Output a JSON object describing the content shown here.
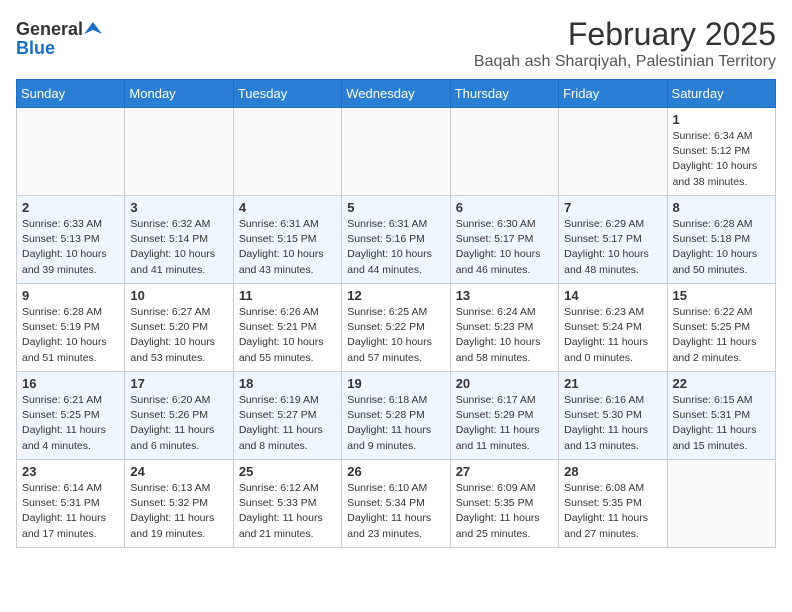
{
  "header": {
    "logo_general": "General",
    "logo_blue": "Blue",
    "month_year": "February 2025",
    "location": "Baqah ash Sharqiyah, Palestinian Territory"
  },
  "weekdays": [
    "Sunday",
    "Monday",
    "Tuesday",
    "Wednesday",
    "Thursday",
    "Friday",
    "Saturday"
  ],
  "weeks": [
    [
      {
        "day": "",
        "info": ""
      },
      {
        "day": "",
        "info": ""
      },
      {
        "day": "",
        "info": ""
      },
      {
        "day": "",
        "info": ""
      },
      {
        "day": "",
        "info": ""
      },
      {
        "day": "",
        "info": ""
      },
      {
        "day": "1",
        "info": "Sunrise: 6:34 AM\nSunset: 5:12 PM\nDaylight: 10 hours\nand 38 minutes."
      }
    ],
    [
      {
        "day": "2",
        "info": "Sunrise: 6:33 AM\nSunset: 5:13 PM\nDaylight: 10 hours\nand 39 minutes."
      },
      {
        "day": "3",
        "info": "Sunrise: 6:32 AM\nSunset: 5:14 PM\nDaylight: 10 hours\nand 41 minutes."
      },
      {
        "day": "4",
        "info": "Sunrise: 6:31 AM\nSunset: 5:15 PM\nDaylight: 10 hours\nand 43 minutes."
      },
      {
        "day": "5",
        "info": "Sunrise: 6:31 AM\nSunset: 5:16 PM\nDaylight: 10 hours\nand 44 minutes."
      },
      {
        "day": "6",
        "info": "Sunrise: 6:30 AM\nSunset: 5:17 PM\nDaylight: 10 hours\nand 46 minutes."
      },
      {
        "day": "7",
        "info": "Sunrise: 6:29 AM\nSunset: 5:17 PM\nDaylight: 10 hours\nand 48 minutes."
      },
      {
        "day": "8",
        "info": "Sunrise: 6:28 AM\nSunset: 5:18 PM\nDaylight: 10 hours\nand 50 minutes."
      }
    ],
    [
      {
        "day": "9",
        "info": "Sunrise: 6:28 AM\nSunset: 5:19 PM\nDaylight: 10 hours\nand 51 minutes."
      },
      {
        "day": "10",
        "info": "Sunrise: 6:27 AM\nSunset: 5:20 PM\nDaylight: 10 hours\nand 53 minutes."
      },
      {
        "day": "11",
        "info": "Sunrise: 6:26 AM\nSunset: 5:21 PM\nDaylight: 10 hours\nand 55 minutes."
      },
      {
        "day": "12",
        "info": "Sunrise: 6:25 AM\nSunset: 5:22 PM\nDaylight: 10 hours\nand 57 minutes."
      },
      {
        "day": "13",
        "info": "Sunrise: 6:24 AM\nSunset: 5:23 PM\nDaylight: 10 hours\nand 58 minutes."
      },
      {
        "day": "14",
        "info": "Sunrise: 6:23 AM\nSunset: 5:24 PM\nDaylight: 11 hours\nand 0 minutes."
      },
      {
        "day": "15",
        "info": "Sunrise: 6:22 AM\nSunset: 5:25 PM\nDaylight: 11 hours\nand 2 minutes."
      }
    ],
    [
      {
        "day": "16",
        "info": "Sunrise: 6:21 AM\nSunset: 5:25 PM\nDaylight: 11 hours\nand 4 minutes."
      },
      {
        "day": "17",
        "info": "Sunrise: 6:20 AM\nSunset: 5:26 PM\nDaylight: 11 hours\nand 6 minutes."
      },
      {
        "day": "18",
        "info": "Sunrise: 6:19 AM\nSunset: 5:27 PM\nDaylight: 11 hours\nand 8 minutes."
      },
      {
        "day": "19",
        "info": "Sunrise: 6:18 AM\nSunset: 5:28 PM\nDaylight: 11 hours\nand 9 minutes."
      },
      {
        "day": "20",
        "info": "Sunrise: 6:17 AM\nSunset: 5:29 PM\nDaylight: 11 hours\nand 11 minutes."
      },
      {
        "day": "21",
        "info": "Sunrise: 6:16 AM\nSunset: 5:30 PM\nDaylight: 11 hours\nand 13 minutes."
      },
      {
        "day": "22",
        "info": "Sunrise: 6:15 AM\nSunset: 5:31 PM\nDaylight: 11 hours\nand 15 minutes."
      }
    ],
    [
      {
        "day": "23",
        "info": "Sunrise: 6:14 AM\nSunset: 5:31 PM\nDaylight: 11 hours\nand 17 minutes."
      },
      {
        "day": "24",
        "info": "Sunrise: 6:13 AM\nSunset: 5:32 PM\nDaylight: 11 hours\nand 19 minutes."
      },
      {
        "day": "25",
        "info": "Sunrise: 6:12 AM\nSunset: 5:33 PM\nDaylight: 11 hours\nand 21 minutes."
      },
      {
        "day": "26",
        "info": "Sunrise: 6:10 AM\nSunset: 5:34 PM\nDaylight: 11 hours\nand 23 minutes."
      },
      {
        "day": "27",
        "info": "Sunrise: 6:09 AM\nSunset: 5:35 PM\nDaylight: 11 hours\nand 25 minutes."
      },
      {
        "day": "28",
        "info": "Sunrise: 6:08 AM\nSunset: 5:35 PM\nDaylight: 11 hours\nand 27 minutes."
      },
      {
        "day": "",
        "info": ""
      }
    ]
  ]
}
